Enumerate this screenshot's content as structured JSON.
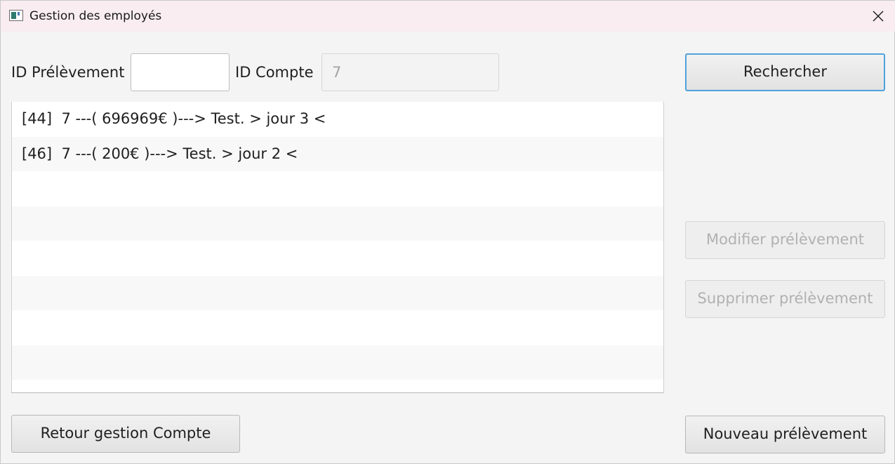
{
  "window": {
    "title": "Gestion des employés"
  },
  "form": {
    "id_prelevement_label": "ID Prélèvement",
    "id_prelevement_value": "",
    "id_compte_label": "ID Compte",
    "id_compte_value": "7"
  },
  "list": {
    "items": [
      "[44]  7 ---( 696969€ )---> Test. > jour 3 <",
      "[46]  7 ---( 200€ )---> Test. > jour 2 <"
    ]
  },
  "buttons": {
    "rechercher": "Rechercher",
    "modifier": "Modifier prélèvement",
    "supprimer": "Supprimer prélèvement",
    "retour": "Retour gestion Compte",
    "nouveau": "Nouveau prélèvement"
  },
  "icons": {
    "app": "app-window-icon",
    "close": "close-icon"
  }
}
